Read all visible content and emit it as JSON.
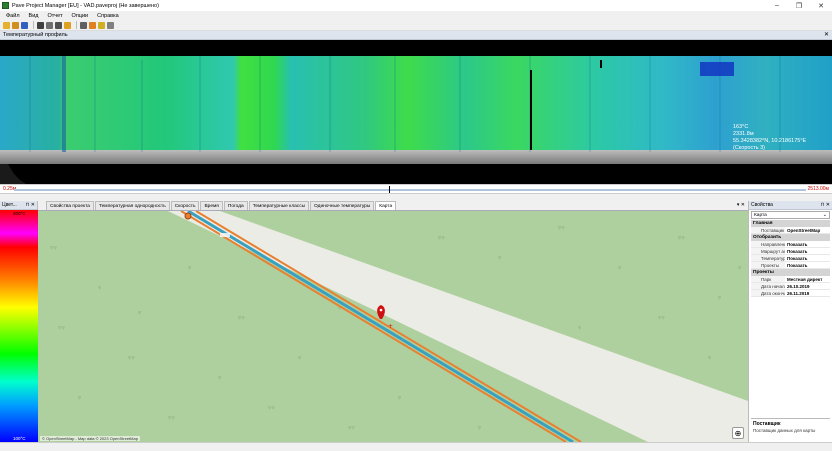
{
  "window": {
    "title": "Pave Project Manager [EU] - VAD.paveproj (Не завершено)"
  },
  "menu": [
    "Файл",
    "Вид",
    "Отчет",
    "Опции",
    "Справка"
  ],
  "thermal_panel": {
    "title": "Температурный профиль",
    "overlay": [
      "163°C",
      "2331.8м",
      "55.3428382°N, 10.2186175°E",
      "(Скорость 3)"
    ],
    "scale_start": "0.25м",
    "scale_end": "2513.00м"
  },
  "legend_panel": {
    "title": "Цвет...",
    "top_value": "200°C",
    "bottom_value": "100°C"
  },
  "tabs": [
    "Свойства проекта",
    "Температурная однородность",
    "Скорость",
    "Время",
    "Погода",
    "Температурные классы",
    "Одиночные температуры",
    "Карта"
  ],
  "map": {
    "attribution": "© OpenStreetMap - Map data © 2023 OpenStreetMap"
  },
  "properties": {
    "title": "Свойства",
    "selector": "Карта",
    "sections": [
      {
        "name": "Главная",
        "rows": [
          {
            "k": "Поставщик",
            "v": "OpenStreetMap"
          }
        ]
      },
      {
        "name": "Отобразить",
        "rows": [
          {
            "k": "Направление",
            "v": "Показать"
          },
          {
            "k": "Маршрут асф",
            "v": "Показать"
          },
          {
            "k": "Температур",
            "v": "Показать"
          },
          {
            "k": "Проекты",
            "v": "Показать"
          }
        ]
      },
      {
        "name": "Проекты",
        "rows": [
          {
            "k": "Парк",
            "v": "Местная директ"
          },
          {
            "k": "Дата начала",
            "v": "26.10.2019"
          },
          {
            "k": "Дата оконча",
            "v": "26.11.2019"
          }
        ]
      }
    ],
    "desc_title": "Поставщик",
    "desc_text": "Поставщик данных для карты"
  },
  "colors": {
    "road": "#ecece6",
    "grass": "#aed09e",
    "track": "#3aa0c0",
    "edge": "#e88030",
    "marker": "#d01010"
  }
}
